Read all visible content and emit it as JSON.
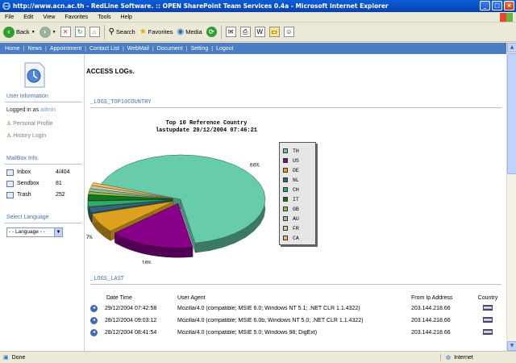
{
  "window": {
    "title": "http://www.acn.ac.th - RedLine Software. :: OPEN SharePoint Team Services 0.4a - Microsoft Internet Explorer"
  },
  "menu": [
    "File",
    "Edit",
    "View",
    "Favorites",
    "Tools",
    "Help"
  ],
  "toolbar": {
    "back": "Back",
    "search": "Search",
    "favorites": "Favorites",
    "media": "Media"
  },
  "nav": [
    "Home",
    "News",
    "Appointment",
    "Contact List",
    "WebMail",
    "Document",
    "Setting",
    "Logout"
  ],
  "sidebar": {
    "user_info_title": "User Information",
    "logged_in_label": "Logged in as",
    "logged_in_user": "admin",
    "personal_profile": "Personal Profile",
    "history_login": "History Login",
    "mailbox_title": "MailBox Info.",
    "mailbox": [
      {
        "label": "Inbox",
        "count": "4/404"
      },
      {
        "label": "Sendbox",
        "count": "81"
      },
      {
        "label": "Trash",
        "count": "252"
      }
    ],
    "language_title": "Select Language",
    "language_value": "- - Language - -"
  },
  "main": {
    "title": "ACCESS LOGs.",
    "section_country": "_LOGS_TOP10COUNTRY",
    "chart_title_1": "Top 10 Reference Country",
    "chart_title_2": "lastupdate 29/12/2004   07:46:21",
    "section_last": "_LOGS_LAST",
    "table_headers": [
      "Date Time",
      "User Agent",
      "From Ip Address",
      "Country"
    ],
    "table_rows": [
      {
        "date": "29/12/2004 07:42:58",
        "agent": "Mozilla/4.0 (compatible; MSIE 6.0; Windows NT 5.1; .NET CLR 1.1.4322)",
        "ip": "203.144.218.66"
      },
      {
        "date": "28/12/2004 09:03:12",
        "agent": "Mozilla/4.0 (compatible; MSIE 6.0b; Windows NT 5.0; .NET CLR 1.1.4322)",
        "ip": "203.144.218.66"
      },
      {
        "date": "28/12/2004 08:41:54",
        "agent": "Mozilla/4.0 (compatible; MSIE 5.0; Windows 98; DigExt)",
        "ip": "203.144.218.66"
      }
    ]
  },
  "status": {
    "left": "Done",
    "zone": "Internet"
  },
  "chart_data": {
    "type": "pie",
    "title": "Top 10 Reference Country",
    "subtitle": "lastupdate 29/12/2004   07:46:21",
    "categories": [
      "TH",
      "US",
      "DE",
      "NL",
      "CH",
      "IT",
      "GB",
      "AU",
      "FR",
      "CA"
    ],
    "values": [
      66,
      16,
      7,
      2,
      2,
      2,
      1,
      1,
      1,
      1
    ],
    "data_labels": [
      "66%",
      "16%",
      "7%",
      "2%",
      "2%",
      "2%",
      "1%",
      "1%",
      "1%",
      "1%"
    ],
    "colors": [
      "#66CCAA",
      "#880088",
      "#DDA122",
      "#336677",
      "#33AA66",
      "#117722",
      "#88BB44",
      "#99BBAA",
      "#CCCC99",
      "#EEBB66"
    ],
    "legend": "right"
  }
}
